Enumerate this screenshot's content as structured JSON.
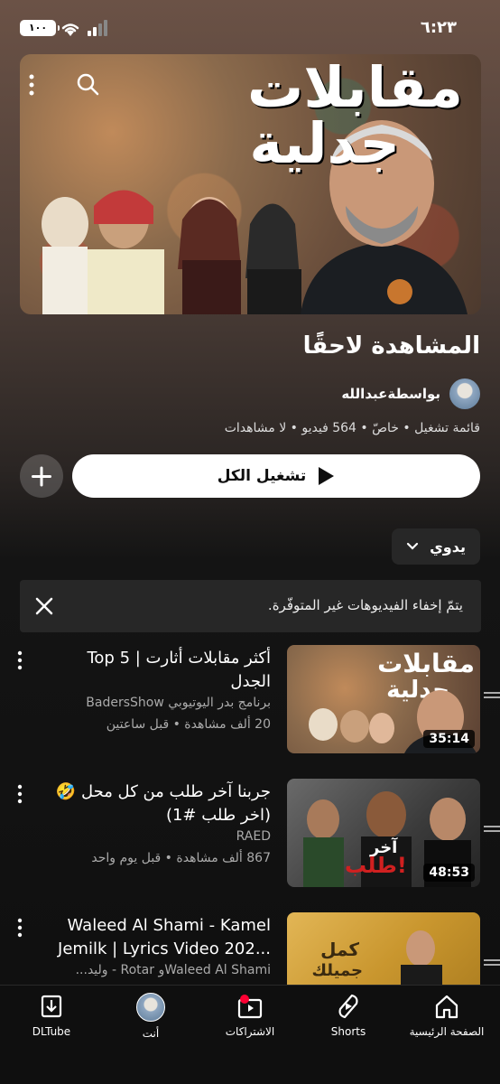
{
  "status": {
    "time": "٦:٢٣",
    "battery": "١٠٠"
  },
  "hero": {
    "title_line1": "مقابلات",
    "title_line2": "جدلية"
  },
  "playlist": {
    "title": "المشاهدة لاحقًا",
    "owner": "بواسطةعبدالله",
    "meta": "قائمة تشغيل • خاصّ • 564 فيديو • لا مشاهدات",
    "play_all": "تشغيل الكل"
  },
  "sort": {
    "label": "يدوي"
  },
  "notice": {
    "text": "يتمّ إخفاء الفيديوهات غير المتوفّرة."
  },
  "videos": [
    {
      "title": "أكثر مقابلات أثارت | Top 5 الجدل",
      "channel": "برنامج بدر اليوتيوبي BadersShow",
      "stats": "20 ألف مشاهدة • قبل ساعتين",
      "duration": "35:14"
    },
    {
      "title": "جربنا آخر طلب من كل محل 🤣 (اخر طلب #1)",
      "channel": "RAED",
      "stats": "867 ألف مشاهدة • قبل يوم واحد",
      "duration": "48:53"
    },
    {
      "title": "Waleed Al Shami - Kamel Jemilk | Lyrics Video 202...",
      "channel": "Waleed Al Shamiو Rotar - وليد...",
      "stats": "",
      "duration": ""
    }
  ],
  "nav": {
    "home": "الصفحة الرئيسية",
    "shorts": "Shorts",
    "subscriptions": "الاشتراكات",
    "you": "أنت",
    "dltube": "DLTube"
  }
}
